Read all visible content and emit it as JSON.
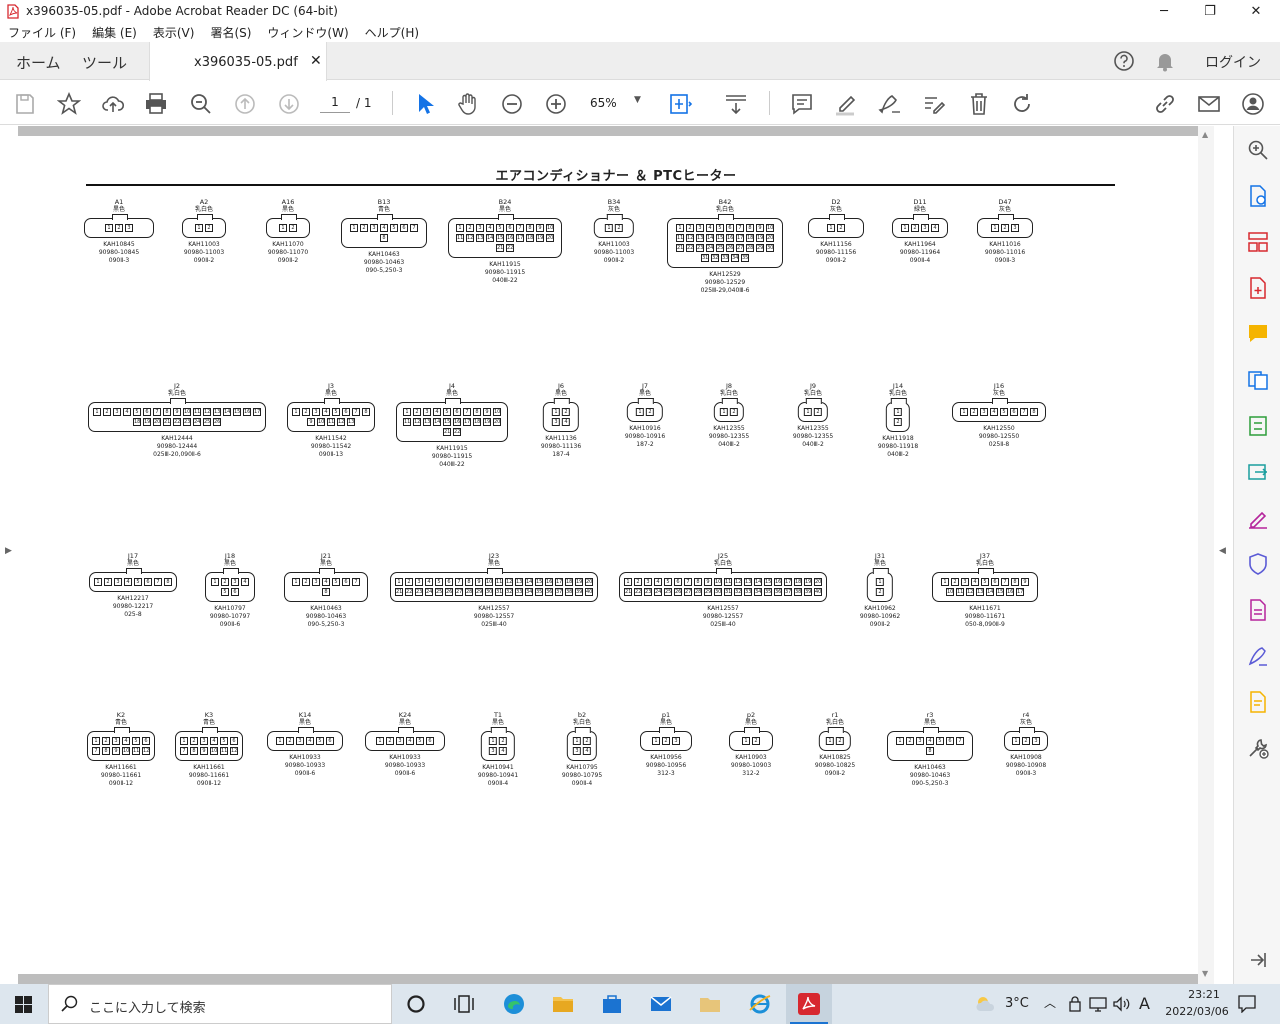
{
  "window": {
    "title": "x396035-05.pdf - Adobe Acrobat Reader DC (64-bit)",
    "minimize": "─",
    "maximize": "❐",
    "close": "✕"
  },
  "menu": [
    "ファイル (F)",
    "編集 (E)",
    "表示(V)",
    "署名(S)",
    "ウィンドウ(W)",
    "ヘルプ(H)"
  ],
  "tabs": {
    "home": "ホーム",
    "tools": "ツール",
    "document": "x396035-05.pdf",
    "close": "✕",
    "login": "ログイン"
  },
  "toolbar": {
    "page_current": "1",
    "page_total": "/ 1",
    "zoom": "65%"
  },
  "document": {
    "title": "エアコンディショナー ＆ PTCヒーター",
    "connectors": [
      {
        "id": "A1",
        "color": "黒色",
        "pn": "KAH10845",
        "part": "90980-10845",
        "spec": "090Ⅱ-3",
        "pins": "1 2 3"
      },
      {
        "id": "A2",
        "color": "乳白色",
        "pn": "KAH11003",
        "part": "90980-11003",
        "spec": "090Ⅱ-2",
        "pins": "1 2"
      },
      {
        "id": "A16",
        "color": "黒色",
        "pn": "KAH11070",
        "part": "90980-11070",
        "spec": "090Ⅱ-2",
        "pins": "1 2"
      },
      {
        "id": "B13",
        "color": "青色",
        "pn": "KAH10463",
        "part": "90980-10463",
        "spec": "090-5,250-3",
        "pins": "1 2 3 4 5 6 7 8"
      },
      {
        "id": "B24",
        "color": "黒色",
        "pn": "KAH11915",
        "part": "90980-11915",
        "spec": "040Ⅲ-22",
        "pins": "1 2 3 4 5 6 7 8 9 10 11 12 13 14 15 16 17 18 19 20 21 22"
      },
      {
        "id": "B34",
        "color": "灰色",
        "pn": "KAH11003",
        "part": "90980-11003",
        "spec": "090Ⅱ-2",
        "pins": "1 2"
      },
      {
        "id": "B42",
        "color": "乳白色",
        "pn": "KAH12529",
        "part": "90980-12529",
        "spec": "025Ⅲ-29,040Ⅲ-6",
        "pins": "1 2 3 4 5 6 7 8 9 10 11 12 13 14 15 16 17 18 19 20 21 22 23 24 25 26 27 28 29 30 31 32 33 34 35"
      },
      {
        "id": "D2",
        "color": "灰色",
        "pn": "KAH11156",
        "part": "90980-11156",
        "spec": "090Ⅱ-2",
        "pins": "1 2"
      },
      {
        "id": "D11",
        "color": "緑色",
        "pn": "KAH11964",
        "part": "90980-11964",
        "spec": "090Ⅱ-4",
        "pins": "1 2 3 4"
      },
      {
        "id": "D47",
        "color": "灰色",
        "pn": "KAH11016",
        "part": "90980-11016",
        "spec": "090Ⅱ-3",
        "pins": "1 2 3"
      },
      {
        "id": "J2",
        "color": "乳白色",
        "pn": "KAH12444",
        "part": "90980-12444",
        "spec": "025Ⅲ-20,090Ⅱ-6",
        "pins": "1 2 3 4 5 6 7 8 9 10 11 12 13 14 15 16 17 18 19 20 21 22 23 24 25 26"
      },
      {
        "id": "J3",
        "color": "黒色",
        "pn": "KAH11542",
        "part": "90980-11542",
        "spec": "090Ⅱ-13",
        "pins": "1 2 3 4 5 6 7 8 9 10 11 12 13"
      },
      {
        "id": "J4",
        "color": "黒色",
        "pn": "KAH11915",
        "part": "90980-11915",
        "spec": "040Ⅲ-22",
        "pins": "1 2 3 4 5 6 7 8 9 10 11 12 13 14 15 16 17 18 19 20 21 22"
      },
      {
        "id": "J6",
        "color": "黒色",
        "pn": "KAH11136",
        "part": "90980-11136",
        "spec": "187-4",
        "pins": "1 2 3 4"
      },
      {
        "id": "J7",
        "color": "黒色",
        "pn": "KAH10916",
        "part": "90980-10916",
        "spec": "187-2",
        "pins": "1 2"
      },
      {
        "id": "J8",
        "color": "乳白色",
        "pn": "KAH12355",
        "part": "90980-12355",
        "spec": "040Ⅲ-2",
        "pins": "1 2"
      },
      {
        "id": "J9",
        "color": "乳白色",
        "pn": "KAH12355",
        "part": "90980-12355",
        "spec": "040Ⅲ-2",
        "pins": "1 2"
      },
      {
        "id": "J14",
        "color": "乳白色",
        "pn": "KAH11918",
        "part": "90980-11918",
        "spec": "040Ⅲ-2",
        "pins": "1 2"
      },
      {
        "id": "J16",
        "color": "灰色",
        "pn": "KAH12550",
        "part": "90980-12550",
        "spec": "025Ⅱ-8",
        "pins": "1 2 3 4 5 6 7 8"
      },
      {
        "id": "J17",
        "color": "黒色",
        "pn": "KAH12217",
        "part": "90980-12217",
        "spec": "025-8",
        "pins": "1 2 3 4 5 6 7 8"
      },
      {
        "id": "J18",
        "color": "黒色",
        "pn": "KAH10797",
        "part": "90980-10797",
        "spec": "090Ⅱ-6",
        "pins": "1 2 3 4 5 6"
      },
      {
        "id": "J21",
        "color": "黒色",
        "pn": "KAH10463",
        "part": "90980-10463",
        "spec": "090-5,250-3",
        "pins": "1 2 3 4 5 6 7 8"
      },
      {
        "id": "J23",
        "color": "黒色",
        "pn": "KAH12557",
        "part": "90980-12557",
        "spec": "025Ⅲ-40",
        "pins": "1 2 3 4 5 6 7 8 9 10 11 12 13 14 15 16 17 18 19 20 21 22 23 24 25 26 27 28 29 30 31 32 33 34 35 36 37 38 39 40"
      },
      {
        "id": "J25",
        "color": "乳白色",
        "pn": "KAH12557",
        "part": "90980-12557",
        "spec": "025Ⅲ-40",
        "pins": "1 2 3 4 5 6 7 8 9 10 11 12 13 14 15 16 17 18 19 20 21 22 23 24 25 26 27 28 29 30 31 32 33 34 35 36 37 38 39 40"
      },
      {
        "id": "J31",
        "color": "黒色",
        "pn": "KAH10962",
        "part": "90980-10962",
        "spec": "090Ⅱ-2",
        "pins": "1 2"
      },
      {
        "id": "J37",
        "color": "乳白色",
        "pn": "KAH11671",
        "part": "90980-11671",
        "spec": "050-8,090Ⅱ-9",
        "pins": "1 2 3 4 5 6 7 8 9 10 11 12 13 14 15 16 17"
      },
      {
        "id": "K2",
        "color": "青色",
        "pn": "KAH11661",
        "part": "90980-11661",
        "spec": "090Ⅱ-12",
        "pins": "1 2 3 4 5 6 7 8 9 10 11 12"
      },
      {
        "id": "K3",
        "color": "青色",
        "pn": "KAH11661",
        "part": "90980-11661",
        "spec": "090Ⅱ-12",
        "pins": "1 2 3 4 5 6 7 8 9 10 11 12"
      },
      {
        "id": "K14",
        "color": "黒色",
        "pn": "KAH10933",
        "part": "90980-10933",
        "spec": "090Ⅱ-6",
        "pins": "1 2 3 4 5 6"
      },
      {
        "id": "K24",
        "color": "黒色",
        "pn": "KAH10933",
        "part": "90980-10933",
        "spec": "090Ⅱ-6",
        "pins": "1 2 3 4 5 6"
      },
      {
        "id": "T1",
        "color": "黒色",
        "pn": "KAH10941",
        "part": "90980-10941",
        "spec": "090Ⅱ-4",
        "pins": "1 2 3 4"
      },
      {
        "id": "b2",
        "color": "乳白色",
        "pn": "KAH10795",
        "part": "90980-10795",
        "spec": "090Ⅱ-4",
        "pins": "1 2 3 4"
      },
      {
        "id": "p1",
        "color": "黒色",
        "pn": "KAH10956",
        "part": "90980-10956",
        "spec": "312-3",
        "pins": "1 2 3"
      },
      {
        "id": "p2",
        "color": "黒色",
        "pn": "KAH10903",
        "part": "90980-10903",
        "spec": "312-2",
        "pins": "1 2"
      },
      {
        "id": "r1",
        "color": "乳白色",
        "pn": "KAH10825",
        "part": "90980-10825",
        "spec": "090Ⅱ-2",
        "pins": "1 2"
      },
      {
        "id": "r3",
        "color": "黒色",
        "pn": "KAH10463",
        "part": "90980-10463",
        "spec": "090-5,250-3",
        "pins": "1 2 3 4 5 6 7 8"
      },
      {
        "id": "r4",
        "color": "灰色",
        "pn": "KAH10908",
        "part": "90980-10908",
        "spec": "090Ⅱ-3",
        "pins": "1 2 3"
      }
    ]
  },
  "taskbar": {
    "search_placeholder": "ここに入力して検索",
    "weather": "3°C",
    "ime": "A",
    "time": "23:21",
    "date": "2022/03/06"
  },
  "colors": {
    "acrobat_red": "#d7282f",
    "accent_blue": "#1473e6",
    "tool_gray": "#6d6d6d"
  }
}
